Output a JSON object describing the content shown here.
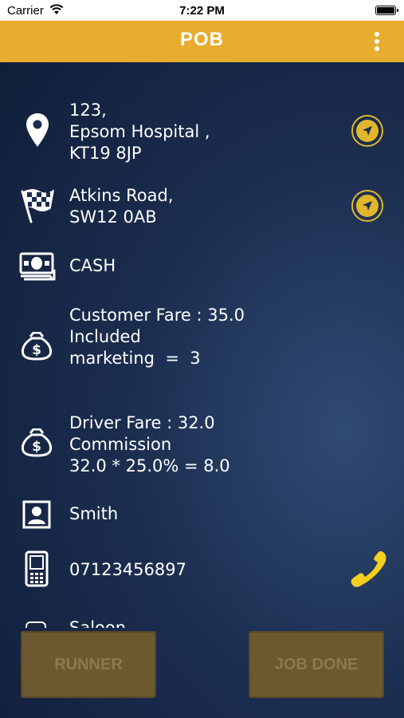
{
  "status_bar": {
    "carrier": "Carrier",
    "time": "7:22 PM"
  },
  "app_bar": {
    "title": "POB"
  },
  "pickup": {
    "line1": "123,",
    "line2": "Epsom Hospital ,",
    "line3": "KT19 8JP"
  },
  "dropoff": {
    "line1": "Atkins Road,",
    "line2": "SW12 0AB"
  },
  "payment": {
    "method": "CASH"
  },
  "customer_fare": {
    "line1": "Customer Fare : 35.0",
    "line2": "Included",
    "line3": "marketing  =  3"
  },
  "driver_fare": {
    "line1": "Driver Fare : 32.0",
    "line2": "Commission",
    "line3": "32.0 * 25.0% = 8.0"
  },
  "customer": {
    "name": "Smith"
  },
  "phone": {
    "number": "07123456897"
  },
  "vehicle": {
    "type": "Saloon"
  },
  "buttons": {
    "runner": "RUNNER",
    "job_done": "JOB DONE"
  },
  "colors": {
    "accent": "#e8ac2e",
    "nav_accent": "#e1b52c",
    "phone_icon": "#f3cf1f"
  },
  "icons": [
    "wifi-icon",
    "battery-icon",
    "more-vert-icon",
    "location-pin-icon",
    "navigate-icon",
    "checkered-flag-icon",
    "cash-icon",
    "money-bag-icon",
    "contact-card-icon",
    "mobile-phone-icon",
    "call-icon",
    "car-icon"
  ]
}
